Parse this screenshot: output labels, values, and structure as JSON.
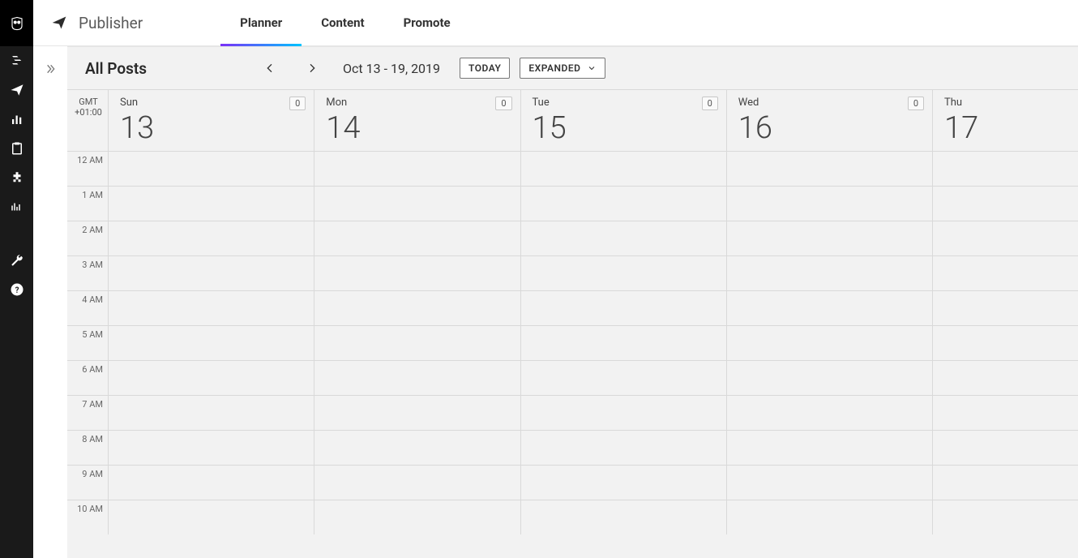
{
  "header": {
    "brand": "Publisher",
    "tabs": [
      "Planner",
      "Content",
      "Promote"
    ],
    "activeTab": 0
  },
  "toolbar": {
    "title": "All Posts",
    "dateRange": "Oct 13 - 19, 2019",
    "todayLabel": "TODAY",
    "viewLabel": "EXPANDED"
  },
  "timezone": {
    "line1": "GMT",
    "line2": "+01:00"
  },
  "days": [
    {
      "dow": "Sun",
      "num": "13",
      "count": "0"
    },
    {
      "dow": "Mon",
      "num": "14",
      "count": "0"
    },
    {
      "dow": "Tue",
      "num": "15",
      "count": "0"
    },
    {
      "dow": "Wed",
      "num": "16",
      "count": "0"
    },
    {
      "dow": "Thu",
      "num": "17",
      "count": ""
    }
  ],
  "hours": [
    "12 AM",
    "1 AM",
    "2 AM",
    "3 AM",
    "4 AM",
    "5 AM",
    "6 AM",
    "7 AM",
    "8 AM",
    "9 AM",
    "10 AM"
  ]
}
